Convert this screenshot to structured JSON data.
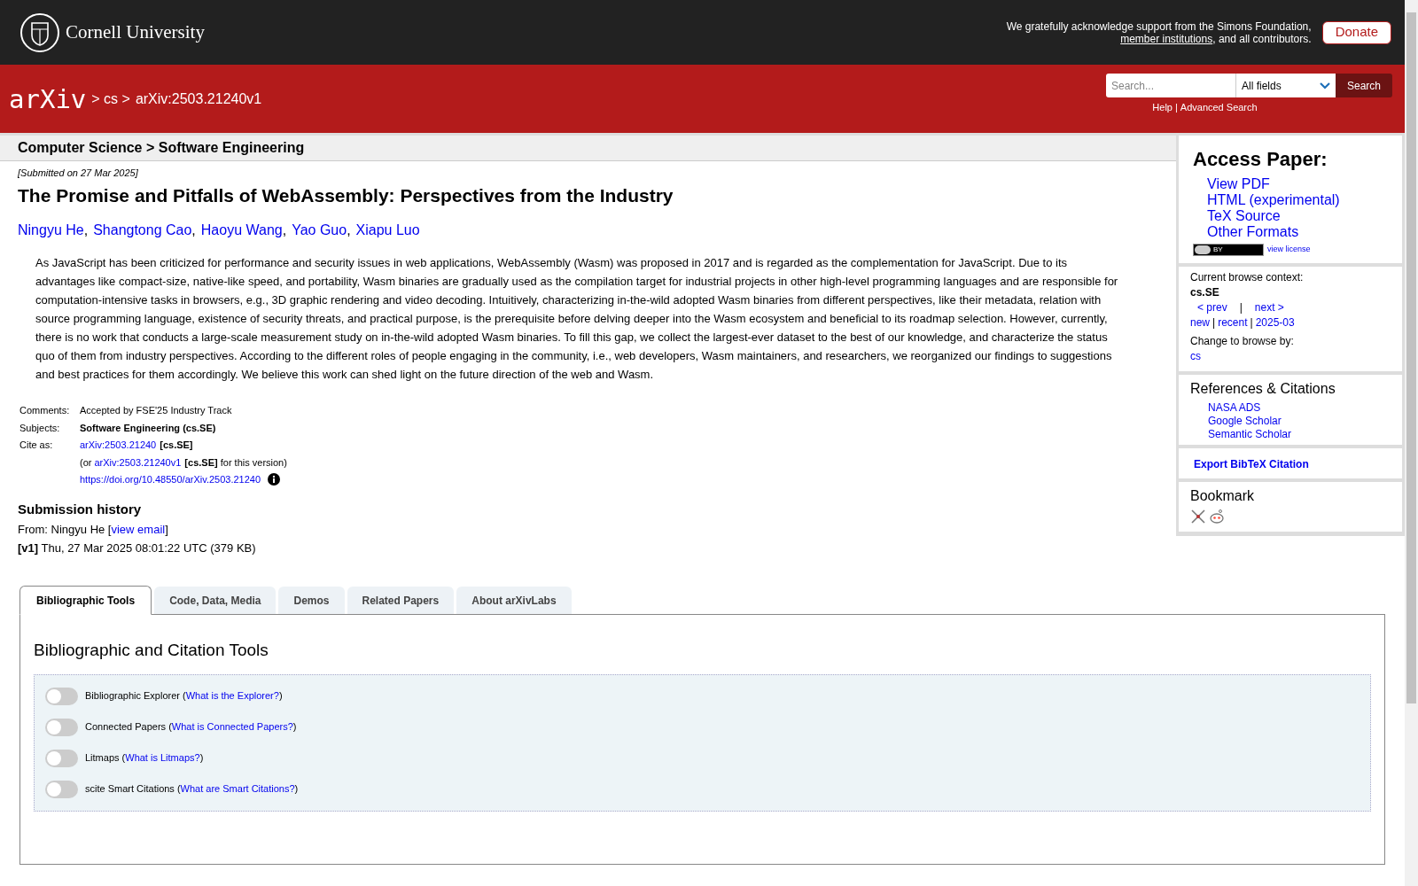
{
  "header": {
    "university": "Cornell University",
    "support_text": "We gratefully acknowledge support from the Simons Foundation, ",
    "support_link": "member institutions",
    "support_tail": ", and all contributors.",
    "donate": "Donate"
  },
  "nav": {
    "logo": "arXiv",
    "breadcrumbs": [
      "> cs >",
      "arXiv:2503.21240v1"
    ],
    "search": {
      "placeholder": "Search..."
    },
    "field_select": "All fields",
    "search_button": "Search",
    "links": [
      "Help",
      "Advanced Search"
    ],
    "sep": "|"
  },
  "subheader": "Computer Science > Software Engineering",
  "paper": {
    "submitted": "[Submitted on 27 Mar 2025]",
    "title": "The Promise and Pitfalls of WebAssembly: Perspectives from the Industry",
    "authors": [
      "Ningyu He",
      "Shangtong Cao",
      "Haoyu Wang",
      "Yao Guo",
      "Xiapu Luo"
    ],
    "author_sep": ",",
    "abstract": "As JavaScript has been criticized for performance and security issues in web applications, WebAssembly (Wasm) was proposed in 2017 and is regarded as the complementation for JavaScript. Due to its advantages like compact-size, native-like speed, and portability, Wasm binaries are gradually used as the compilation target for industrial projects in other high-level programming languages and are responsible for computation-intensive tasks in browsers, e.g., 3D graphic rendering and video decoding. Intuitively, characterizing in-the-wild adopted Wasm binaries from different perspectives, like their metadata, relation with source programming language, existence of security threats, and practical purpose, is the prerequisite before delving deeper into the Wasm ecosystem and beneficial to its roadmap selection. However, currently, there is no work that conducts a large-scale measurement study on in-the-wild adopted Wasm binaries. To fill this gap, we collect the largest-ever dataset to the best of our knowledge, and characterize the status quo of them from industry perspectives. According to the different roles of people engaging in the community, i.e., web developers, Wasm maintainers, and researchers, we reorganized our findings to suggestions and best practices for them accordingly. We believe this work can shed light on the future direction of the web and Wasm.",
    "meta": {
      "comments_label": "Comments:",
      "comments": "Accepted by FSE'25 Industry Track",
      "subjects_label": "Subjects:",
      "subjects": "Software Engineering (cs.SE)",
      "cite_label": "Cite as:",
      "cite_link": "arXiv:2503.21240",
      "cite_tag": "[cs.SE]",
      "version_open": "(or ",
      "version_link": "arXiv:2503.21240v1",
      "version_tag": "[cs.SE]",
      "version_tail": " for this version)",
      "doi": "https://doi.org/10.48550/arXiv.2503.21240"
    },
    "history": {
      "title": "Submission history",
      "from": "From: Ningyu He [",
      "email_link": "view email",
      "from_close": "]",
      "version": "[v1]",
      "version_text": " Thu, 27 Mar 2025 08:01:22 UTC (379 KB)"
    }
  },
  "sidebar": {
    "access_title": "Access Paper:",
    "access_links": [
      "View PDF",
      "HTML (experimental)",
      "TeX Source",
      "Other Formats"
    ],
    "license_badge": "BY",
    "license_link": "view license",
    "context_label": "Current browse context:",
    "context": "cs.SE",
    "prev": "< prev",
    "sep": "|",
    "next": "next >",
    "browse_links": [
      "new",
      "recent",
      "2025-03"
    ],
    "change_label": "Change to browse by:",
    "change_link": "cs",
    "refs_title": "References & Citations",
    "refs_links": [
      "NASA ADS",
      "Google Scholar",
      "Semantic Scholar"
    ],
    "export": "Export BibTeX Citation",
    "bookmark_title": "Bookmark"
  },
  "tabs": [
    {
      "label": "Bibliographic Tools",
      "selected": true
    },
    {
      "label": "Code, Data, Media",
      "selected": false
    },
    {
      "label": "Demos",
      "selected": false
    },
    {
      "label": "Related Papers",
      "selected": false
    },
    {
      "label": "About arXivLabs",
      "selected": false
    }
  ],
  "tools": {
    "title": "Bibliographic and Citation Tools",
    "open": "(",
    "close": ")",
    "items": [
      {
        "label": "Bibliographic Explorer",
        "link": "What is the Explorer?",
        "on": false
      },
      {
        "label": "Connected Papers",
        "link": "What is Connected Papers?",
        "on": false
      },
      {
        "label": "Litmaps",
        "link": "What is Litmaps?",
        "on": false
      },
      {
        "label": "scite Smart Citations",
        "link": "What are Smart Citations?",
        "on": false
      }
    ]
  }
}
